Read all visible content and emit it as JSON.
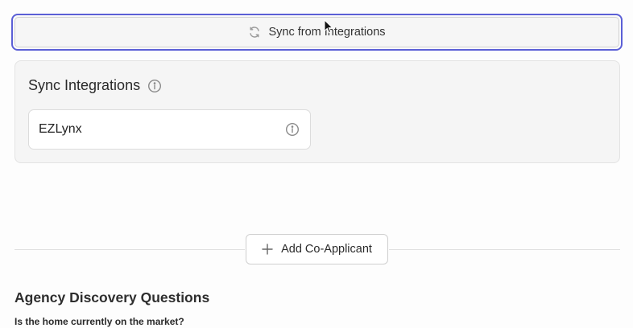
{
  "sync": {
    "button_label": "Sync from Integrations",
    "icon": "refresh-icon",
    "focus_ring_color": "#5b5fd6"
  },
  "integrations_panel": {
    "title": "Sync Integrations",
    "title_icon": "info-icon",
    "items": [
      {
        "name": "EZLynx",
        "icon": "info-icon"
      }
    ]
  },
  "co_applicant": {
    "button_label": "Add Co-Applicant",
    "icon": "plus-icon"
  },
  "discovery": {
    "title": "Agency Discovery Questions",
    "questions": [
      {
        "label": "Is the home currently on the market?"
      }
    ]
  }
}
